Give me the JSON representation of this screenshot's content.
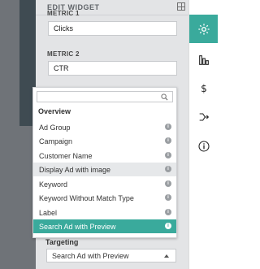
{
  "header": {
    "title": "EDIT WIDGET",
    "icon": "layout-toggle-icon"
  },
  "metric1": {
    "label": "METRIC 1",
    "value": "Clicks"
  },
  "metric2": {
    "label": "METRIC 2",
    "value": "CTR"
  },
  "dropdown": {
    "search_value": "",
    "group": "Overview",
    "items": [
      {
        "label": "Ad Group",
        "state": "normal"
      },
      {
        "label": "Campaign",
        "state": "normal"
      },
      {
        "label": "Customer Name",
        "state": "normal"
      },
      {
        "label": "Display Ad with image",
        "state": "hover"
      },
      {
        "label": "Keyword",
        "state": "normal"
      },
      {
        "label": "Keyword Without Match Type",
        "state": "normal"
      },
      {
        "label": "Label",
        "state": "normal"
      },
      {
        "label": "Search Ad with Preview",
        "state": "selected"
      }
    ]
  },
  "targeting": {
    "label": "Targeting",
    "value": "Search Ad with Preview"
  },
  "rail": {
    "items": [
      {
        "name": "settings-gear-icon",
        "active": true
      },
      {
        "name": "bar-chart-icon",
        "active": false
      },
      {
        "name": "dollar-icon",
        "active": false
      },
      {
        "name": "flow-icon",
        "active": false
      },
      {
        "name": "info-icon",
        "active": false
      }
    ]
  },
  "colors": {
    "accent": "#3aaa9c",
    "panel": "#e3e4e6",
    "hover": "#e6e8ea"
  }
}
